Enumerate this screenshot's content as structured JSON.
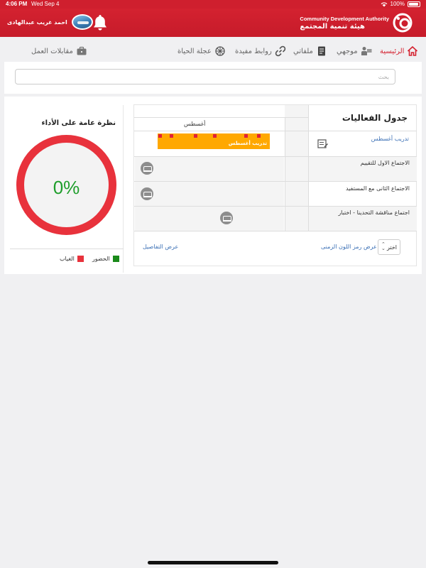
{
  "status_bar": {
    "time": "4:06 PM",
    "date": "Wed Sep 4",
    "battery": "100%"
  },
  "header": {
    "user_name": "احمد غريب عبدالهادى",
    "logo_en": "Community Development Authority",
    "logo_ar": "هيئة تنمية المجتمع",
    "brand_color": "#d42230"
  },
  "nav": {
    "items": [
      {
        "label": "الرئيسية",
        "icon": "home-icon",
        "active": true
      },
      {
        "label": "موجهي",
        "icon": "mentor-icon"
      },
      {
        "label": "ملفاتي",
        "icon": "files-icon"
      },
      {
        "label": "روابط مفيدة",
        "icon": "link-icon"
      },
      {
        "label": "عجلة الحياة",
        "icon": "wheel-icon"
      },
      {
        "label": "مقابلات العمل",
        "icon": "briefcase-icon"
      }
    ]
  },
  "search": {
    "placeholder": "بحث"
  },
  "events": {
    "title": "جدول الفعاليات",
    "month": "أغسطس",
    "rows": [
      {
        "name": "تدريب أغسطس",
        "bar_label": "تدريب أغسطس"
      },
      {
        "name": "الاجتماع الاول للتقييم"
      },
      {
        "name": "الاجتماع الثانى مع المستفيد"
      },
      {
        "name": "اجتماع مناقشة التحدينا - اختبار"
      }
    ],
    "select_value": "اختر",
    "legend_link": "عرض رمز اللون الزمنى",
    "details_link": "عرض التفاصيل"
  },
  "performance": {
    "title": "نظرة عامة على الأداء",
    "percent_label": "0%",
    "attendance_fraction": 0.0,
    "legend": [
      {
        "label": "الحضور",
        "color": "#1a8a1a"
      },
      {
        "label": "الغياب",
        "color": "#e8323c"
      }
    ],
    "ring_color": "#e8323c",
    "percent_color": "#1f9e2c"
  }
}
